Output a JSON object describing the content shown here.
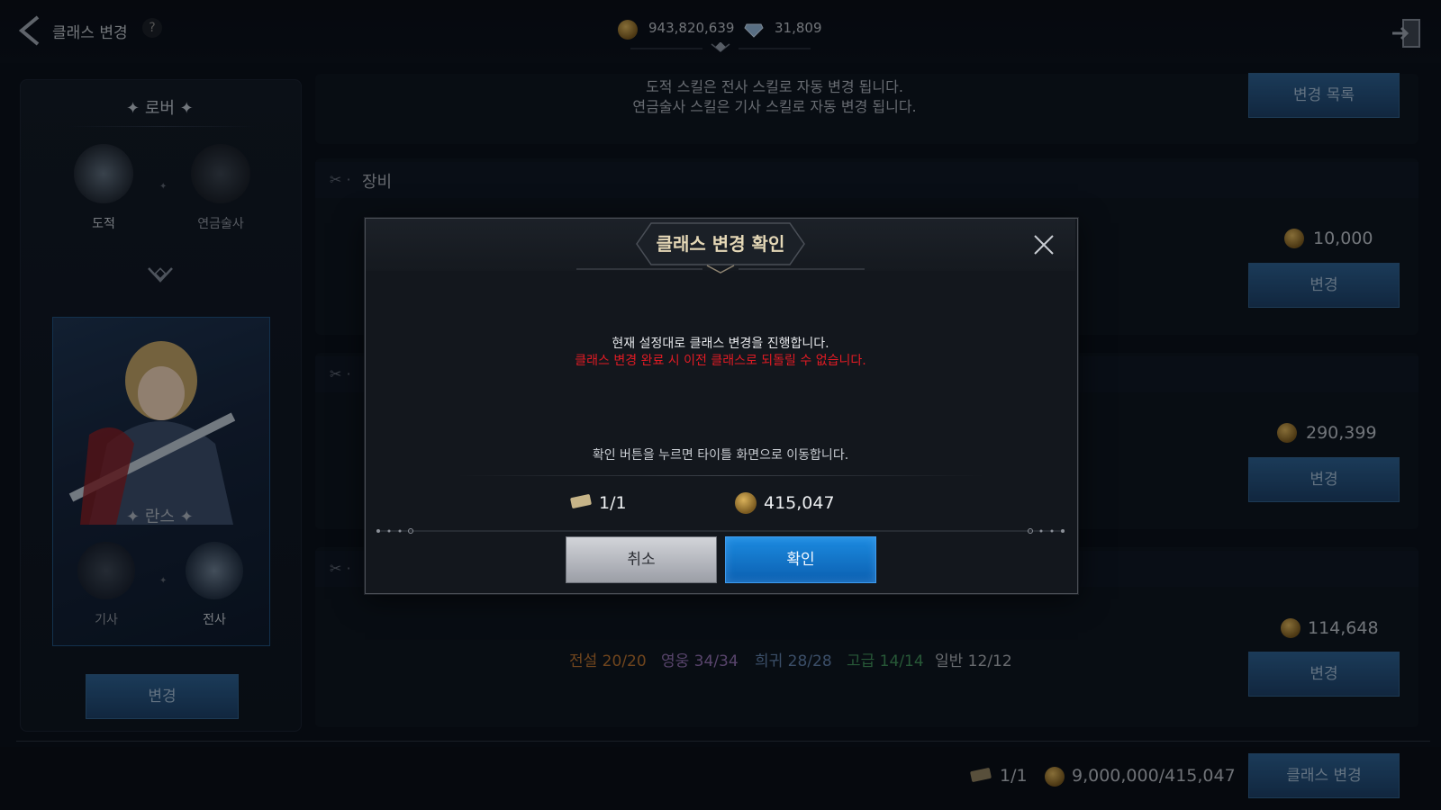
{
  "header": {
    "title": "클래스 변경",
    "help": "?",
    "gold": "943,820,639",
    "diamond": "31,809"
  },
  "left_panel": {
    "origin_class": "로버",
    "origin_sub": [
      "도적",
      "연금술사"
    ],
    "target_class": "란스",
    "target_sub": [
      "기사",
      "전사"
    ],
    "change_button": "변경"
  },
  "main": {
    "info_lines": [
      "도적 스킬은 전사 스킬로 자동 변경 됩니다.",
      "연금술사 스킬은 기사 스킬로 자동 변경 됩니다."
    ],
    "change_list_button": "변경 목록",
    "equipment_title": "장비",
    "rows": [
      {
        "cost": "10,000",
        "button": "변경"
      },
      {
        "cost": "290,399",
        "button": "변경"
      },
      {
        "cost": "114,648",
        "button": "변경"
      }
    ],
    "grades": [
      {
        "label": "전설 20/20",
        "color": "#b5702f"
      },
      {
        "label": "영웅 34/34",
        "color": "#8f6fae"
      },
      {
        "label": "희귀 28/28",
        "color": "#5f7fa8"
      },
      {
        "label": "고급 14/14",
        "color": "#3f8f5a"
      },
      {
        "label": "일반 12/12",
        "color": "#a9adb3"
      }
    ]
  },
  "footer": {
    "tickets": "1/1",
    "gold_req": "9,000,000/415,047",
    "class_change_button": "클래스 변경"
  },
  "dialog": {
    "title": "클래스 변경 확인",
    "line1": "현재 설정대로 클래스 변경을 진행합니다.",
    "line2": "클래스 변경 완료 시 이전 클래스로 되돌릴 수 없습니다.",
    "line3": "확인 버튼을 누르면 타이틀 화면으로 이동합니다.",
    "tickets": "1/1",
    "gold": "415,047",
    "cancel": "취소",
    "confirm": "확인"
  }
}
